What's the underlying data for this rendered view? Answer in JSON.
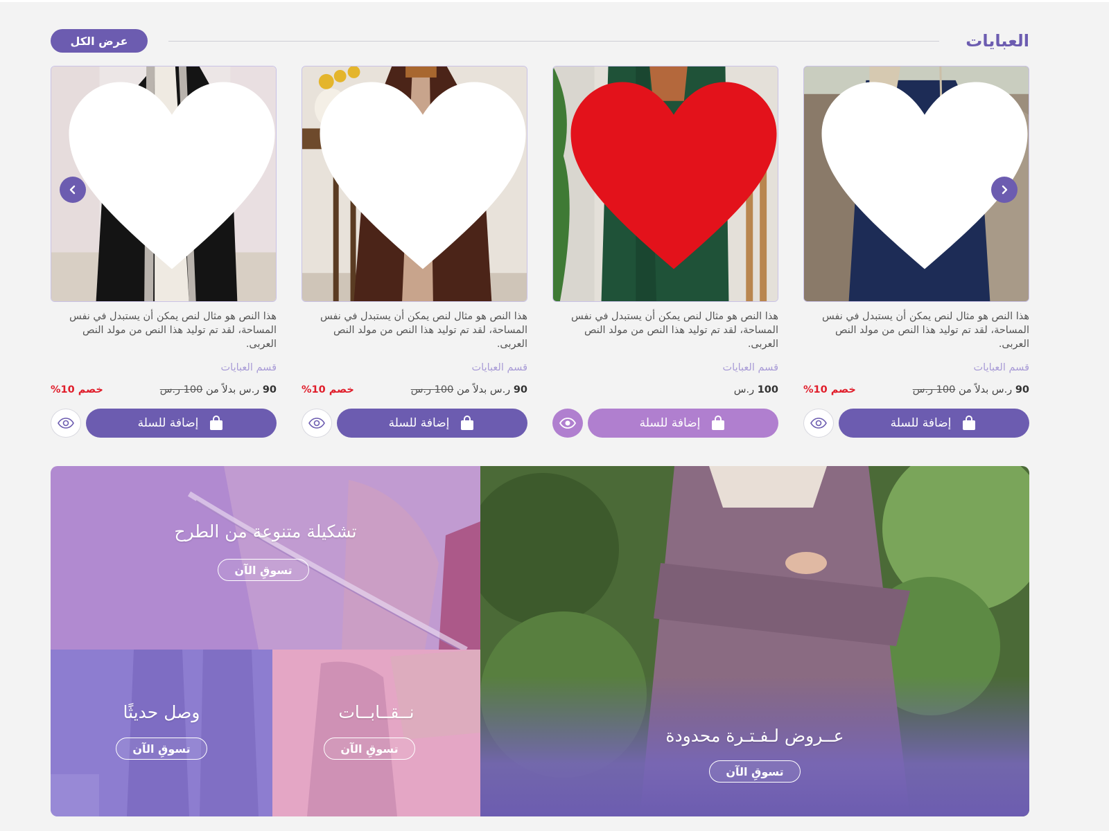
{
  "section": {
    "title": "العبايات",
    "view_all": "عرض الكل"
  },
  "products": [
    {
      "description": "هذا النص هو مثال لنص يمكن أن يستبدل في نفس المساحة، لقد تم توليد هذا النص من مولد النص العربى.",
      "category": "قسم العبايات",
      "price": "90",
      "price_text": "ر.س بدلاً من",
      "old_price": "100 ر.س",
      "discount": "خصم 10%",
      "add_to_cart": "إضافة للسلة",
      "favorite": false,
      "image": "black-white-abaya"
    },
    {
      "description": "هذا النص هو مثال لنص يمكن أن يستبدل في نفس المساحة، لقد تم توليد هذا النص من مولد النص العربى.",
      "category": "قسم العبايات",
      "price": "90",
      "price_text": "ر.س بدلاً من",
      "old_price": "100 ر.س",
      "discount": "خصم 10%",
      "add_to_cart": "إضافة للسلة",
      "favorite": false,
      "image": "brown-abaya"
    },
    {
      "description": "هذا النص هو مثال لنص يمكن أن يستبدل في نفس المساحة، لقد تم توليد هذا النص من مولد النص العربى.",
      "category": "قسم العبايات",
      "price": "100",
      "price_text": "ر.س",
      "old_price": "",
      "discount": "",
      "add_to_cart": "إضافة للسلة",
      "favorite": true,
      "image": "green-abaya"
    },
    {
      "description": "هذا النص هو مثال لنص يمكن أن يستبدل في نفس المساحة، لقد تم توليد هذا النص من مولد النص العربى.",
      "category": "قسم العبايات",
      "price": "90",
      "price_text": "ر.س بدلاً من",
      "old_price": "100 ر.س",
      "discount": "خصم 10%",
      "add_to_cart": "إضافة للسلة",
      "favorite": false,
      "image": "navy-abaya"
    }
  ],
  "banners": {
    "variety": {
      "title": "تشكيلة متنوعة من الطرح",
      "button": "تسوقِ الآن"
    },
    "new": {
      "title": "وصل حديثًا",
      "button": "تسوقِ الآن"
    },
    "niqab": {
      "title": "نــقــابــات",
      "button": "تسوقِ الآن"
    },
    "offers": {
      "title": "عــروض لـفـتـرة محدودة",
      "button": "تسوقِ الآن"
    }
  },
  "colors": {
    "accent": "#6c5cb0",
    "accent_light": "#b07fcf",
    "discount": "#e01e2b",
    "category": "#a89bd6"
  },
  "icons": [
    "chevron-left-icon",
    "chevron-right-icon",
    "heart-icon",
    "eye-icon",
    "shopping-bag-icon"
  ]
}
